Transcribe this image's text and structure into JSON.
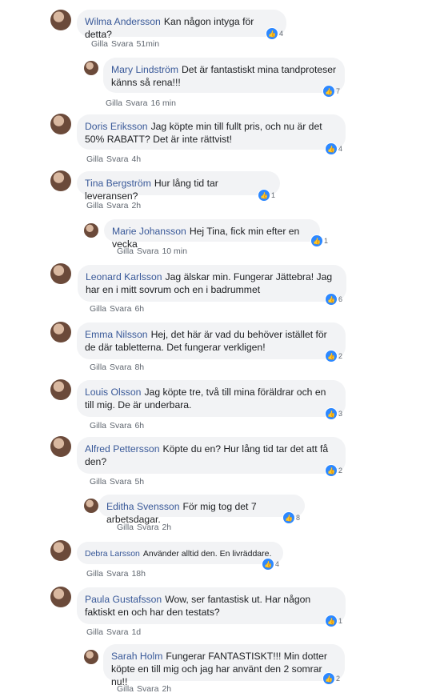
{
  "meta_actions": {
    "like": "Gilla",
    "reply": "Svara"
  },
  "comments": [
    {
      "name": "Wilma Andersson",
      "text": "Kan någon intyga för detta?",
      "time": "51min",
      "likes": "4"
    },
    {
      "name": "Mary Lindström",
      "text": "Det är fantastiskt mina tandproteser känns så rena!!!",
      "time": "16 min",
      "likes": "7"
    },
    {
      "name": "Doris Eriksson",
      "text": "Jag köpte min till fullt pris, och nu är det 50% RABATT? Det är inte rättvist!",
      "time": "4h",
      "likes": "4"
    },
    {
      "name": "Tina Bergström",
      "text": "Hur lång tid tar leveransen?",
      "time": "2h",
      "likes": "1"
    },
    {
      "name": "Marie Johansson",
      "text": "Hej Tina, fick min efter en vecka",
      "time": "10 min",
      "likes": "1"
    },
    {
      "name": "Leonard Karlsson",
      "text": "Jag älskar min. Fungerar Jättebra! Jag har en i mitt sovrum och en i badrummet",
      "time": "6h",
      "likes": "6"
    },
    {
      "name": "Emma Nilsson",
      "text": "Hej, det här är vad du behöver istället för de där tabletterna. Det fungerar verkligen!",
      "time": "8h",
      "likes": "2"
    },
    {
      "name": "Louis Olsson",
      "text": "Jag köpte tre, två till mina föräldrar och en till mig. De är underbara.",
      "time": "6h",
      "likes": "3"
    },
    {
      "name": "Alfred Pettersson",
      "text": "Köpte du en? Hur lång tid tar det att få den?",
      "time": "5h",
      "likes": "2"
    },
    {
      "name": "Editha Svensson",
      "text": "För mig tog det 7 arbetsdagar.",
      "time": "2h",
      "likes": "8"
    },
    {
      "name": "Debra Larsson",
      "text": "Använder alltid den. En livräddare.",
      "time": "18h",
      "likes": "4"
    },
    {
      "name": "Paula Gustafsson",
      "text": "Wow, ser fantastisk ut. Har någon faktiskt en och har den testats?",
      "time": "1d",
      "likes": "1"
    },
    {
      "name": "Sarah Holm",
      "text": "Fungerar FANTASTISKT!!! Min dotter köpte en till mig och jag har använt den 2 somrar nu!!",
      "time": "2h",
      "likes": "2"
    }
  ],
  "colors": {
    "author": "#385898",
    "bubble": "#f2f3f5",
    "like": "#2d88ff",
    "meta": "#606770"
  },
  "icons": {
    "like": "thumbs-up-icon"
  }
}
